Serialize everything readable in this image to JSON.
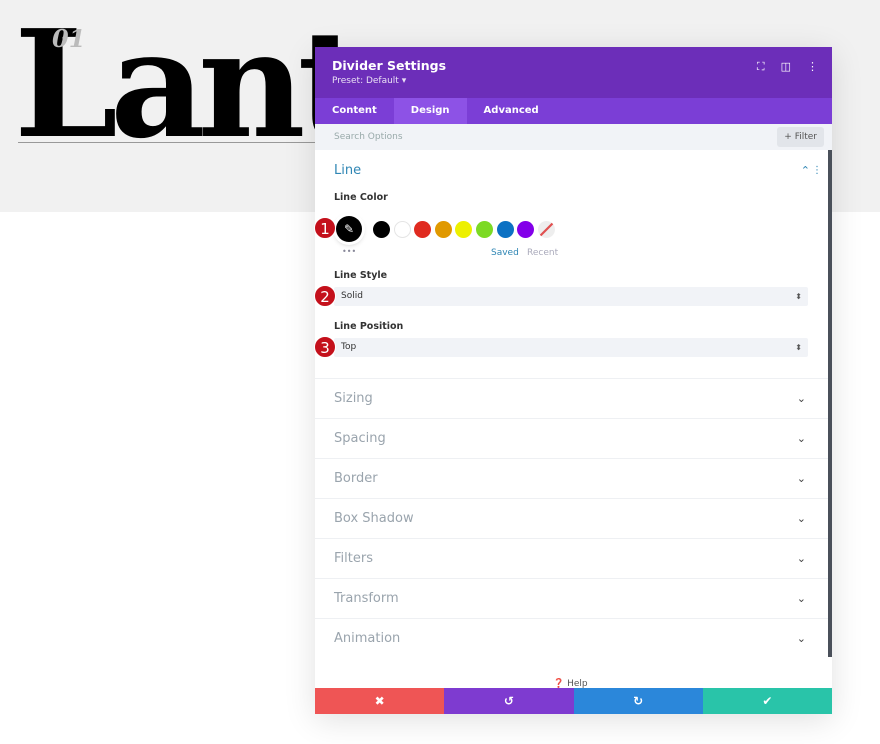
{
  "hero": {
    "number": "01",
    "word": "Lant"
  },
  "panel": {
    "title": "Divider Settings",
    "preset": "Preset: Default ▾",
    "tabs": [
      {
        "label": "Content"
      },
      {
        "label": "Design"
      },
      {
        "label": "Advanced"
      }
    ],
    "search_placeholder": "Search Options",
    "filter_label": "+ Filter",
    "line": {
      "title": "Line",
      "color_label": "Line Color",
      "swatches": [
        "#000000",
        "#ffffff",
        "#e02b20",
        "#e09900",
        "#edf000",
        "#7cda24",
        "#0c71c3",
        "#8300e9"
      ],
      "saved": "Saved",
      "recent": "Recent",
      "more": "•••",
      "style_label": "Line Style",
      "style_value": "Solid",
      "position_label": "Line Position",
      "position_value": "Top"
    },
    "sections": [
      {
        "label": "Sizing"
      },
      {
        "label": "Spacing"
      },
      {
        "label": "Border"
      },
      {
        "label": "Box Shadow"
      },
      {
        "label": "Filters"
      },
      {
        "label": "Transform"
      },
      {
        "label": "Animation"
      }
    ],
    "help": "Help",
    "footer_colors": {
      "cancel": "#ef5555",
      "undo": "#7e3bd0",
      "redo": "#2b87da",
      "save": "#29c4a9"
    }
  },
  "badges": [
    "1",
    "2",
    "3"
  ]
}
